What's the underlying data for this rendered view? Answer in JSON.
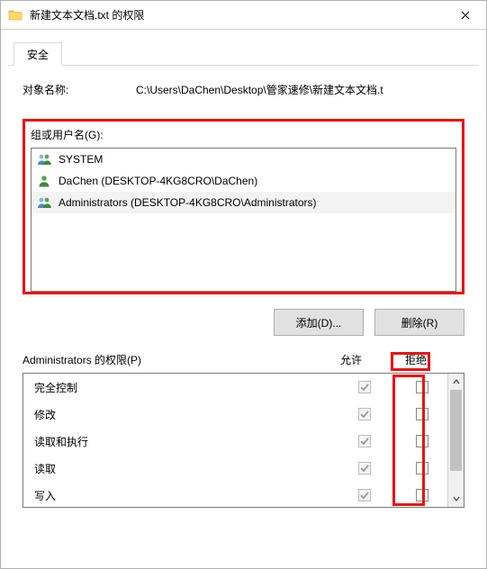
{
  "window": {
    "title": "新建文本文档.txt 的权限"
  },
  "tab": {
    "security": "安全"
  },
  "object": {
    "label": "对象名称:",
    "path": "C:\\Users\\DaChen\\Desktop\\管家速修\\新建文本文档.t"
  },
  "groups": {
    "label": "组或用户名(G):",
    "items": [
      {
        "display": "SYSTEM",
        "type": "group"
      },
      {
        "display": "DaChen (DESKTOP-4KG8CRO\\DaChen)",
        "type": "user"
      },
      {
        "display": "Administrators (DESKTOP-4KG8CRO\\Administrators)",
        "type": "group"
      }
    ],
    "selected_index": 2
  },
  "buttons": {
    "add": "添加(D)...",
    "remove": "删除(R)"
  },
  "permissions": {
    "title": "Administrators 的权限(P)",
    "allow_label": "允许",
    "deny_label": "拒绝",
    "rows": [
      {
        "name": "完全控制",
        "allow": true,
        "allow_enabled": false,
        "deny": false,
        "deny_enabled": true
      },
      {
        "name": "修改",
        "allow": true,
        "allow_enabled": false,
        "deny": false,
        "deny_enabled": true
      },
      {
        "name": "读取和执行",
        "allow": true,
        "allow_enabled": false,
        "deny": false,
        "deny_enabled": true
      },
      {
        "name": "读取",
        "allow": true,
        "allow_enabled": false,
        "deny": false,
        "deny_enabled": true
      },
      {
        "name": "写入",
        "allow": true,
        "allow_enabled": false,
        "deny": false,
        "deny_enabled": true
      }
    ]
  }
}
